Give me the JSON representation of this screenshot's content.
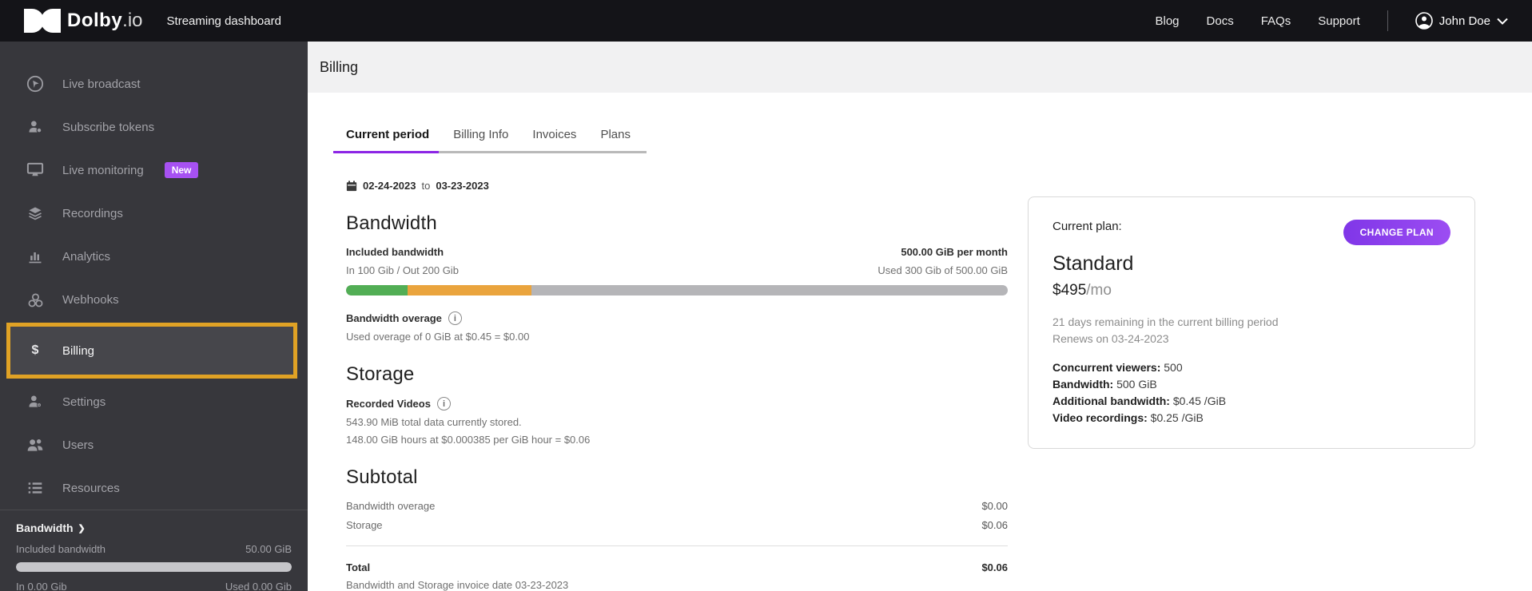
{
  "topbar": {
    "logo_text": "Dolby",
    "logo_suffix": ".io",
    "app_name": "Streaming dashboard",
    "links": [
      "Blog",
      "Docs",
      "FAQs",
      "Support"
    ],
    "user_name": "John Doe"
  },
  "sidebar": {
    "items": [
      {
        "label": "Live broadcast"
      },
      {
        "label": "Subscribe tokens"
      },
      {
        "label": "Live monitoring",
        "badge": "New"
      },
      {
        "label": "Recordings"
      },
      {
        "label": "Analytics"
      },
      {
        "label": "Webhooks"
      },
      {
        "label": "Billing",
        "active": true
      },
      {
        "label": "Settings"
      },
      {
        "label": "Users"
      },
      {
        "label": "Resources"
      }
    ],
    "usage": {
      "title": "Bandwidth",
      "chevron": "❯",
      "included_label": "Included bandwidth",
      "included_value": "50.00 GiB",
      "bar_pct": "100%",
      "in_label": "In 0.00 Gib",
      "used_label": "Used 0.00 Gib"
    }
  },
  "page": {
    "title": "Billing"
  },
  "tabs": [
    {
      "label": "Current period",
      "active": true
    },
    {
      "label": "Billing Info"
    },
    {
      "label": "Invoices"
    },
    {
      "label": "Plans"
    }
  ],
  "period": {
    "start": "02-24-2023",
    "separator": "to",
    "end": "03-23-2023"
  },
  "bandwidth": {
    "heading": "Bandwidth",
    "included_label": "Included bandwidth",
    "quota": "500.00 GiB per month",
    "in_out": "In 100 Gib / Out 200 Gib",
    "used": "Used 300 Gib of 500.00 GiB",
    "progress": {
      "in_pct": "9.3%",
      "out_pct": "18.7%"
    },
    "overage_label": "Bandwidth overage",
    "overage_detail": "Used overage of 0 GiB at $0.45 = $0.00"
  },
  "storage": {
    "heading": "Storage",
    "recorded_label": "Recorded Videos",
    "stored_line": "543.90 MiB total data currently stored.",
    "hours_line": "148.00 GiB hours at $0.000385 per GiB hour = $0.06"
  },
  "subtotal": {
    "heading": "Subtotal",
    "rows": [
      {
        "label": "Bandwidth overage",
        "value": "$0.00"
      },
      {
        "label": "Storage",
        "value": "$0.06"
      }
    ],
    "total_label": "Total",
    "total_value": "$0.06",
    "invoice_note": "Bandwidth and Storage invoice date 03-23-2023"
  },
  "plan_card": {
    "current_label": "Current plan:",
    "change_button": "CHANGE PLAN",
    "name": "Standard",
    "price": "$495",
    "price_suffix": "/mo",
    "remaining": "21 days remaining in the current billing period",
    "renews": "Renews on 03-24-2023",
    "details": [
      {
        "label": "Concurrent viewers:",
        "value": "500"
      },
      {
        "label": "Bandwidth:",
        "value": "500 GiB"
      },
      {
        "label": "Additional bandwidth:",
        "value": "$0.45 /GiB"
      },
      {
        "label": "Video recordings:",
        "value": "$0.25 /GiB"
      }
    ]
  },
  "colors": {
    "topbar_bg": "#141418",
    "sidebar_bg": "#37373c",
    "highlight_border": "#e0a225",
    "active_item_bg": "#46464b",
    "badge_purple": "#a751f2",
    "tab_underline_purple": "#8c25e5",
    "progress_green": "#52ae55",
    "progress_orange": "#eaa43d",
    "progress_track": "#b5b5b8",
    "button_gradient_start": "#8036e8",
    "button_gradient_end": "#9c4df2"
  }
}
